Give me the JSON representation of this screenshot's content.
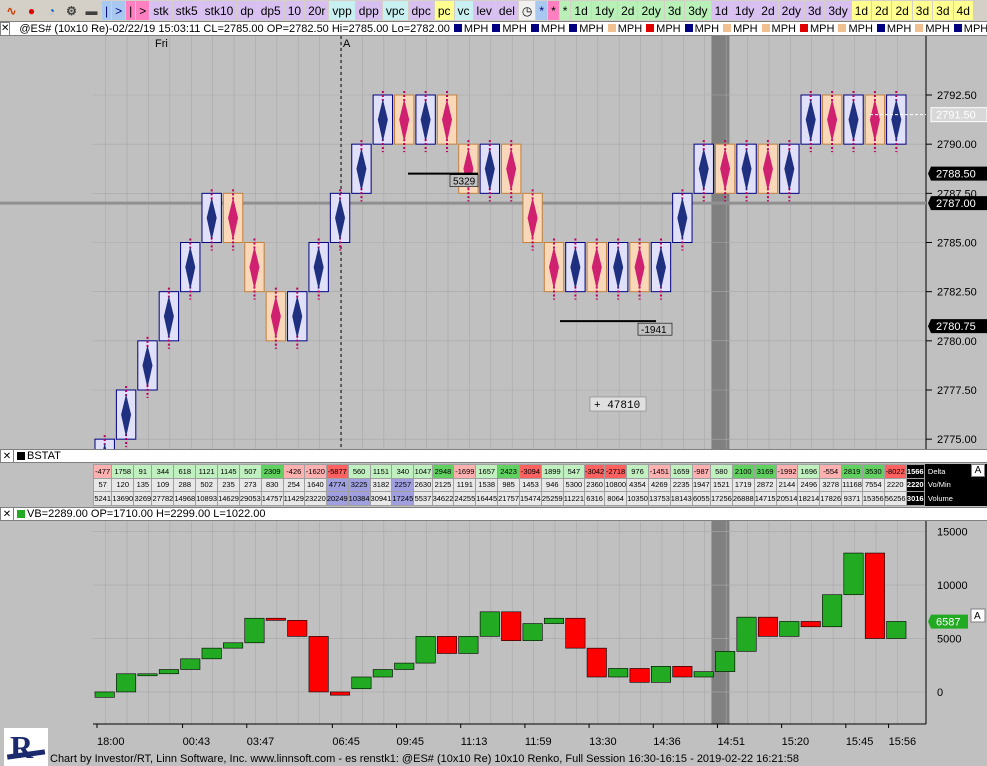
{
  "toolbar": {
    "icons": [
      {
        "name": "wave-icon",
        "glyph": "∿",
        "color": "#d04000"
      },
      {
        "name": "record-icon",
        "glyph": "●",
        "color": "#e00000"
      },
      {
        "name": "refresh-icon",
        "glyph": "◔",
        "color": "#0060d0"
      },
      {
        "name": "gear-icon",
        "glyph": "⚙",
        "color": "#404040"
      },
      {
        "name": "trash-icon",
        "glyph": "▬",
        "color": "#404040"
      }
    ],
    "buttons": [
      {
        "name": "cursor-button",
        "label": "|",
        "cls": "c-blue"
      },
      {
        "name": "next-button",
        "label": ">",
        "cls": "c-blue"
      },
      {
        "name": "pink-cursor-button",
        "label": "|",
        "cls": "c-pink"
      },
      {
        "name": "pink-next-button",
        "label": ">",
        "cls": "c-pink"
      },
      {
        "name": "stk-button",
        "label": "stk",
        "cls": "c-lilac"
      },
      {
        "name": "stk5-button",
        "label": "stk5",
        "cls": "c-lilac"
      },
      {
        "name": "stk10-button",
        "label": "stk10",
        "cls": "c-lilac"
      },
      {
        "name": "dp-button",
        "label": "dp",
        "cls": "c-lilac"
      },
      {
        "name": "dp5-button",
        "label": "dp5",
        "cls": "c-lilac"
      },
      {
        "name": "10-button",
        "label": "10",
        "cls": "c-lilac"
      },
      {
        "name": "20r-button",
        "label": "20r",
        "cls": "c-lilac"
      },
      {
        "name": "vpp-button",
        "label": "vpp",
        "cls": "c-cyan"
      },
      {
        "name": "dpp-button",
        "label": "dpp",
        "cls": "c-lilac"
      },
      {
        "name": "vpc-button",
        "label": "vpc",
        "cls": "c-cyan"
      },
      {
        "name": "dpc-button",
        "label": "dpc",
        "cls": "c-lilac"
      },
      {
        "name": "pc-button",
        "label": "pc",
        "cls": "c-yellow"
      },
      {
        "name": "vc-button",
        "label": "vc",
        "cls": "c-cyan"
      },
      {
        "name": "lev-button",
        "label": "lev",
        "cls": "c-lilac"
      },
      {
        "name": "del-button",
        "label": "del",
        "cls": "c-lilac"
      },
      {
        "name": "clock-button",
        "label": "◷",
        "cls": "c-white"
      },
      {
        "name": "star-blue-button",
        "label": "*",
        "cls": "c-blue"
      },
      {
        "name": "star-pink-button",
        "label": "*",
        "cls": "c-pink"
      },
      {
        "name": "star-green-button",
        "label": "*",
        "cls": "c-green"
      },
      {
        "name": "1d-button",
        "label": "1d",
        "cls": "c-green"
      },
      {
        "name": "1dy-button",
        "label": "1dy",
        "cls": "c-green"
      },
      {
        "name": "2d-button",
        "label": "2d",
        "cls": "c-green"
      },
      {
        "name": "2dy-button",
        "label": "2dy",
        "cls": "c-green"
      },
      {
        "name": "3d-button",
        "label": "3d",
        "cls": "c-green"
      },
      {
        "name": "3dy-button",
        "label": "3dy",
        "cls": "c-green"
      },
      {
        "name": "1d-lilac-button",
        "label": "1d",
        "cls": "c-lilac"
      },
      {
        "name": "1dy-lilac-button",
        "label": "1dy",
        "cls": "c-lilac"
      },
      {
        "name": "2d-lilac-button",
        "label": "2d",
        "cls": "c-lilac"
      },
      {
        "name": "2dy-lilac-button",
        "label": "2dy",
        "cls": "c-lilac"
      },
      {
        "name": "3d-lilac-button",
        "label": "3d",
        "cls": "c-lilac"
      },
      {
        "name": "3dy-lilac-button",
        "label": "3dy",
        "cls": "c-lilac"
      },
      {
        "name": "1d-yellow-button",
        "label": "1d",
        "cls": "c-yellow"
      },
      {
        "name": "2d-yellow-button",
        "label": "2d",
        "cls": "c-yellow"
      },
      {
        "name": "2d-y2-button",
        "label": "2d",
        "cls": "c-yellow"
      },
      {
        "name": "3d-yellow-button",
        "label": "3d",
        "cls": "c-yellow"
      },
      {
        "name": "3d-y2-button",
        "label": "3d",
        "cls": "c-yellow"
      },
      {
        "name": "4d-yellow-button",
        "label": "4d",
        "cls": "c-yellow"
      }
    ]
  },
  "price_panel": {
    "header": "@ES# (10x10 Re)-02/22/19 15:03:11 CL=2785.00 OP=2782.50 Hi=2785.00 Lo=2782.00",
    "legend": [
      {
        "label": "MPH",
        "color": "#000080"
      },
      {
        "label": "MPH",
        "color": "#000080"
      },
      {
        "label": "MPH",
        "color": "#000080"
      },
      {
        "label": "MPH",
        "color": "#000080"
      },
      {
        "label": "MPH",
        "color": "#f0c090"
      },
      {
        "label": "MPH",
        "color": "#e00000"
      },
      {
        "label": "MPH",
        "color": "#000080"
      },
      {
        "label": "MPH",
        "color": "#f0c090"
      },
      {
        "label": "MPH",
        "color": "#f0c090"
      },
      {
        "label": "MPH",
        "color": "#e00000"
      },
      {
        "label": "MPH",
        "color": "#f0c090"
      },
      {
        "label": "MPH",
        "color": "#000080"
      },
      {
        "label": "MPH",
        "color": "#f0c090"
      },
      {
        "label": "MPH",
        "color": "#000080"
      },
      {
        "label": "MPH",
        "color": "#000080"
      }
    ],
    "day_label": "Fri",
    "marker_label": "A",
    "price_ticks": [
      "2792.50",
      "2790.00",
      "2787.50",
      "2785.00",
      "2782.50",
      "2780.00",
      "2777.50",
      "2775.00"
    ],
    "price_tags": [
      {
        "label": "2791.50",
        "style": "ghost"
      },
      {
        "label": "2788.50",
        "style": "dark"
      },
      {
        "label": "2787.00",
        "style": "dark"
      },
      {
        "label": "2780.75",
        "style": "dark"
      }
    ],
    "annotations": {
      "upper_delta": "5329",
      "lower_delta": "-1941",
      "cum_delta": "+ 47810"
    }
  },
  "chart_data": {
    "type": "renko",
    "brick_size": 2.5,
    "bricks": [
      {
        "o": 2772.5,
        "c": 2775.0
      },
      {
        "o": 2775.0,
        "c": 2777.5
      },
      {
        "o": 2777.5,
        "c": 2780.0
      },
      {
        "o": 2780.0,
        "c": 2782.5
      },
      {
        "o": 2782.5,
        "c": 2785.0
      },
      {
        "o": 2785.0,
        "c": 2787.5
      },
      {
        "o": 2787.5,
        "c": 2785.0
      },
      {
        "o": 2785.0,
        "c": 2782.5
      },
      {
        "o": 2782.5,
        "c": 2780.0
      },
      {
        "o": 2780.0,
        "c": 2782.5
      },
      {
        "o": 2782.5,
        "c": 2785.0
      },
      {
        "o": 2785.0,
        "c": 2787.5
      },
      {
        "o": 2787.5,
        "c": 2790.0
      },
      {
        "o": 2790.0,
        "c": 2792.5
      },
      {
        "o": 2792.5,
        "c": 2790.0
      },
      {
        "o": 2790.0,
        "c": 2792.5
      },
      {
        "o": 2792.5,
        "c": 2790.0
      },
      {
        "o": 2790.0,
        "c": 2787.5
      },
      {
        "o": 2787.5,
        "c": 2790.0
      },
      {
        "o": 2790.0,
        "c": 2787.5
      },
      {
        "o": 2787.5,
        "c": 2785.0
      },
      {
        "o": 2785.0,
        "c": 2782.5
      },
      {
        "o": 2782.5,
        "c": 2785.0
      },
      {
        "o": 2785.0,
        "c": 2782.5
      },
      {
        "o": 2782.5,
        "c": 2785.0
      },
      {
        "o": 2785.0,
        "c": 2782.5
      },
      {
        "o": 2782.5,
        "c": 2785.0
      },
      {
        "o": 2785.0,
        "c": 2787.5
      },
      {
        "o": 2787.5,
        "c": 2790.0
      },
      {
        "o": 2790.0,
        "c": 2787.5
      },
      {
        "o": 2787.5,
        "c": 2790.0
      },
      {
        "o": 2790.0,
        "c": 2787.5
      },
      {
        "o": 2787.5,
        "c": 2790.0
      },
      {
        "o": 2790.0,
        "c": 2792.5
      },
      {
        "o": 2792.5,
        "c": 2790.0
      },
      {
        "o": 2790.0,
        "c": 2792.5
      },
      {
        "o": 2792.5,
        "c": 2790.0
      },
      {
        "o": 2790.0,
        "c": 2792.5
      }
    ],
    "y_range": [
      2774.5,
      2795.5
    ],
    "time_labels": [
      "18:00",
      "00:43",
      "03:47",
      "06:45",
      "09:45",
      "11:13",
      "11:59",
      "13:30",
      "14:36",
      "14:51",
      "15:20",
      "15:45",
      "15:56"
    ],
    "volume_bars": {
      "label_y_ticks": [
        "15000",
        "10000",
        "5000",
        "0"
      ],
      "y_range": [
        -3000,
        16000
      ],
      "bars": [
        {
          "o": -500,
          "c": 0
        },
        {
          "o": 0,
          "c": 1700
        },
        {
          "o": 1700,
          "c": 1700
        },
        {
          "o": 1700,
          "c": 2100
        },
        {
          "o": 2100,
          "c": 3100
        },
        {
          "o": 3100,
          "c": 4100
        },
        {
          "o": 4100,
          "c": 4600
        },
        {
          "o": 4600,
          "c": 6900
        },
        {
          "o": 6900,
          "c": 6700
        },
        {
          "o": 6700,
          "c": 5200
        },
        {
          "o": 5200,
          "c": 0
        },
        {
          "o": 0,
          "c": -300
        },
        {
          "o": 300,
          "c": 1400
        },
        {
          "o": 1400,
          "c": 2100
        },
        {
          "o": 2100,
          "c": 2700
        },
        {
          "o": 2700,
          "c": 5200
        },
        {
          "o": 5200,
          "c": 3600
        },
        {
          "o": 3600,
          "c": 5200
        },
        {
          "o": 5200,
          "c": 7500
        },
        {
          "o": 7500,
          "c": 4800
        },
        {
          "o": 4800,
          "c": 6400
        },
        {
          "o": 6400,
          "c": 6900
        },
        {
          "o": 6900,
          "c": 4100
        },
        {
          "o": 4100,
          "c": 1400
        },
        {
          "o": 1400,
          "c": 2200
        },
        {
          "o": 2200,
          "c": 900
        },
        {
          "o": 900,
          "c": 2400
        },
        {
          "o": 2400,
          "c": 1400
        },
        {
          "o": 1400,
          "c": 1900
        },
        {
          "o": 1900,
          "c": 3800
        },
        {
          "o": 3800,
          "c": 7000
        },
        {
          "o": 7000,
          "c": 5200
        },
        {
          "o": 5200,
          "c": 6600
        },
        {
          "o": 6600,
          "c": 6100
        },
        {
          "o": 6100,
          "c": 9100
        },
        {
          "o": 9100,
          "c": 13000
        },
        {
          "o": 13000,
          "c": 5000
        },
        {
          "o": 5000,
          "c": 6600
        }
      ],
      "current_tag": "6587"
    }
  },
  "stat_panel": {
    "title": "BSTAT",
    "rows": [
      {
        "label": "Delta",
        "total": "1566",
        "values": [
          "-477",
          "1758",
          "91",
          "344",
          "618",
          "1121",
          "1145",
          "507",
          "2309",
          "-426",
          "-1620",
          "-5877",
          "560",
          "1151",
          "340",
          "1047",
          "2948",
          "-1699",
          "1657",
          "2423",
          "-3094",
          "1899",
          "547",
          "-3042",
          "-2718",
          "976",
          "-1451",
          "1659",
          "-987",
          "580",
          "2100",
          "3169",
          "-1992",
          "1696",
          "-554",
          "2819",
          "3530",
          "-8022"
        ]
      },
      {
        "label": "Vo/Min",
        "total": "2220",
        "values": [
          "57",
          "120",
          "135",
          "109",
          "288",
          "502",
          "235",
          "273",
          "830",
          "254",
          "1640",
          "4774",
          "3225",
          "3182",
          "2257",
          "2630",
          "2125",
          "1191",
          "1538",
          "985",
          "1453",
          "946",
          "5300",
          "2360",
          "10800",
          "4354",
          "4269",
          "2235",
          "1947",
          "1521",
          "1719",
          "2872",
          "2144",
          "2496",
          "3278",
          "11168",
          "7554",
          "2220"
        ]
      },
      {
        "label": "Volume",
        "total": "3016",
        "values": [
          "5241",
          "13690",
          "3269",
          "27782",
          "14968",
          "10893",
          "14629",
          "29053",
          "14757",
          "11429",
          "23220",
          "20249",
          "10384",
          "30941",
          "17245",
          "5537",
          "34622",
          "24255",
          "16445",
          "21757",
          "15474",
          "25259",
          "11221",
          "6316",
          "8064",
          "10350",
          "13753",
          "18143",
          "6055",
          "17256",
          "26888",
          "14715",
          "20514",
          "18214",
          "17826",
          "9371",
          "15356",
          "56256"
        ]
      }
    ]
  },
  "volume_panel": {
    "header": "VB=2289.00 OP=1710.00 H=2299.00 L=1022.00"
  },
  "status_bar": "Chart by Investor/RT, Linn Software, Inc. www.linnsoft.com - es renstk1: @ES# (10x10 Re) 10x10 Renko, Full Session 16:30-16:15 - 2019-02-22 16:21:58",
  "logo": {
    "text": "IRT"
  },
  "colors": {
    "up_fill": "#e0e0f8",
    "up_edge": "#000080",
    "down_fill": "#f8d8b8",
    "down_edge": "#c08040",
    "vol_up": "#22aa22",
    "vol_down": "#ff0000",
    "session_band": "#808080"
  }
}
